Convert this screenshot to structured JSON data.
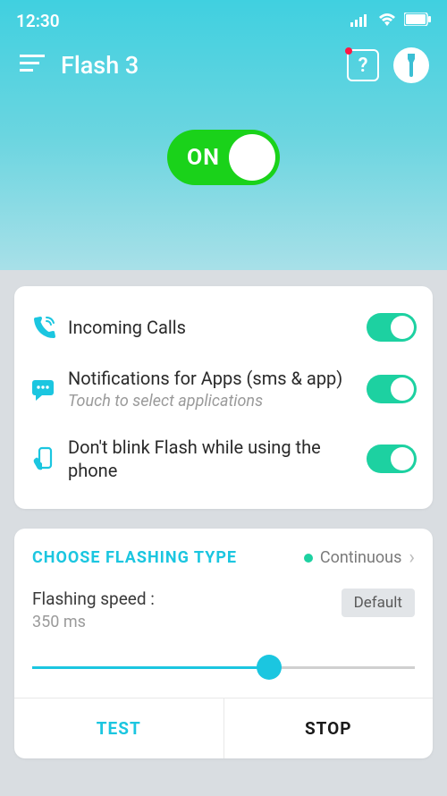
{
  "status": {
    "time": "12:30"
  },
  "header": {
    "title": "Flash 3"
  },
  "main_toggle": {
    "label": "ON",
    "state": true
  },
  "options": [
    {
      "icon": "phone-ring-icon",
      "title": "Incoming Calls",
      "sub": "",
      "on": true
    },
    {
      "icon": "chat-icon",
      "title": "Notifications for Apps (sms & app)",
      "sub": "Touch to select applications",
      "on": true
    },
    {
      "icon": "phone-hand-icon",
      "title": "Don't blink Flash while using the phone",
      "sub": "",
      "on": true
    }
  ],
  "flashing": {
    "section_title": "CHOOSE FLASHING TYPE",
    "type_label": "Continuous",
    "speed_label": "Flashing speed :",
    "speed_value": "350 ms",
    "default_label": "Default",
    "slider_pct": 62
  },
  "buttons": {
    "test": "TEST",
    "stop": "STOP"
  },
  "colors": {
    "accent": "#1bc6e0",
    "success": "#1dd1a1",
    "toggle_on": "#1ad21a"
  }
}
